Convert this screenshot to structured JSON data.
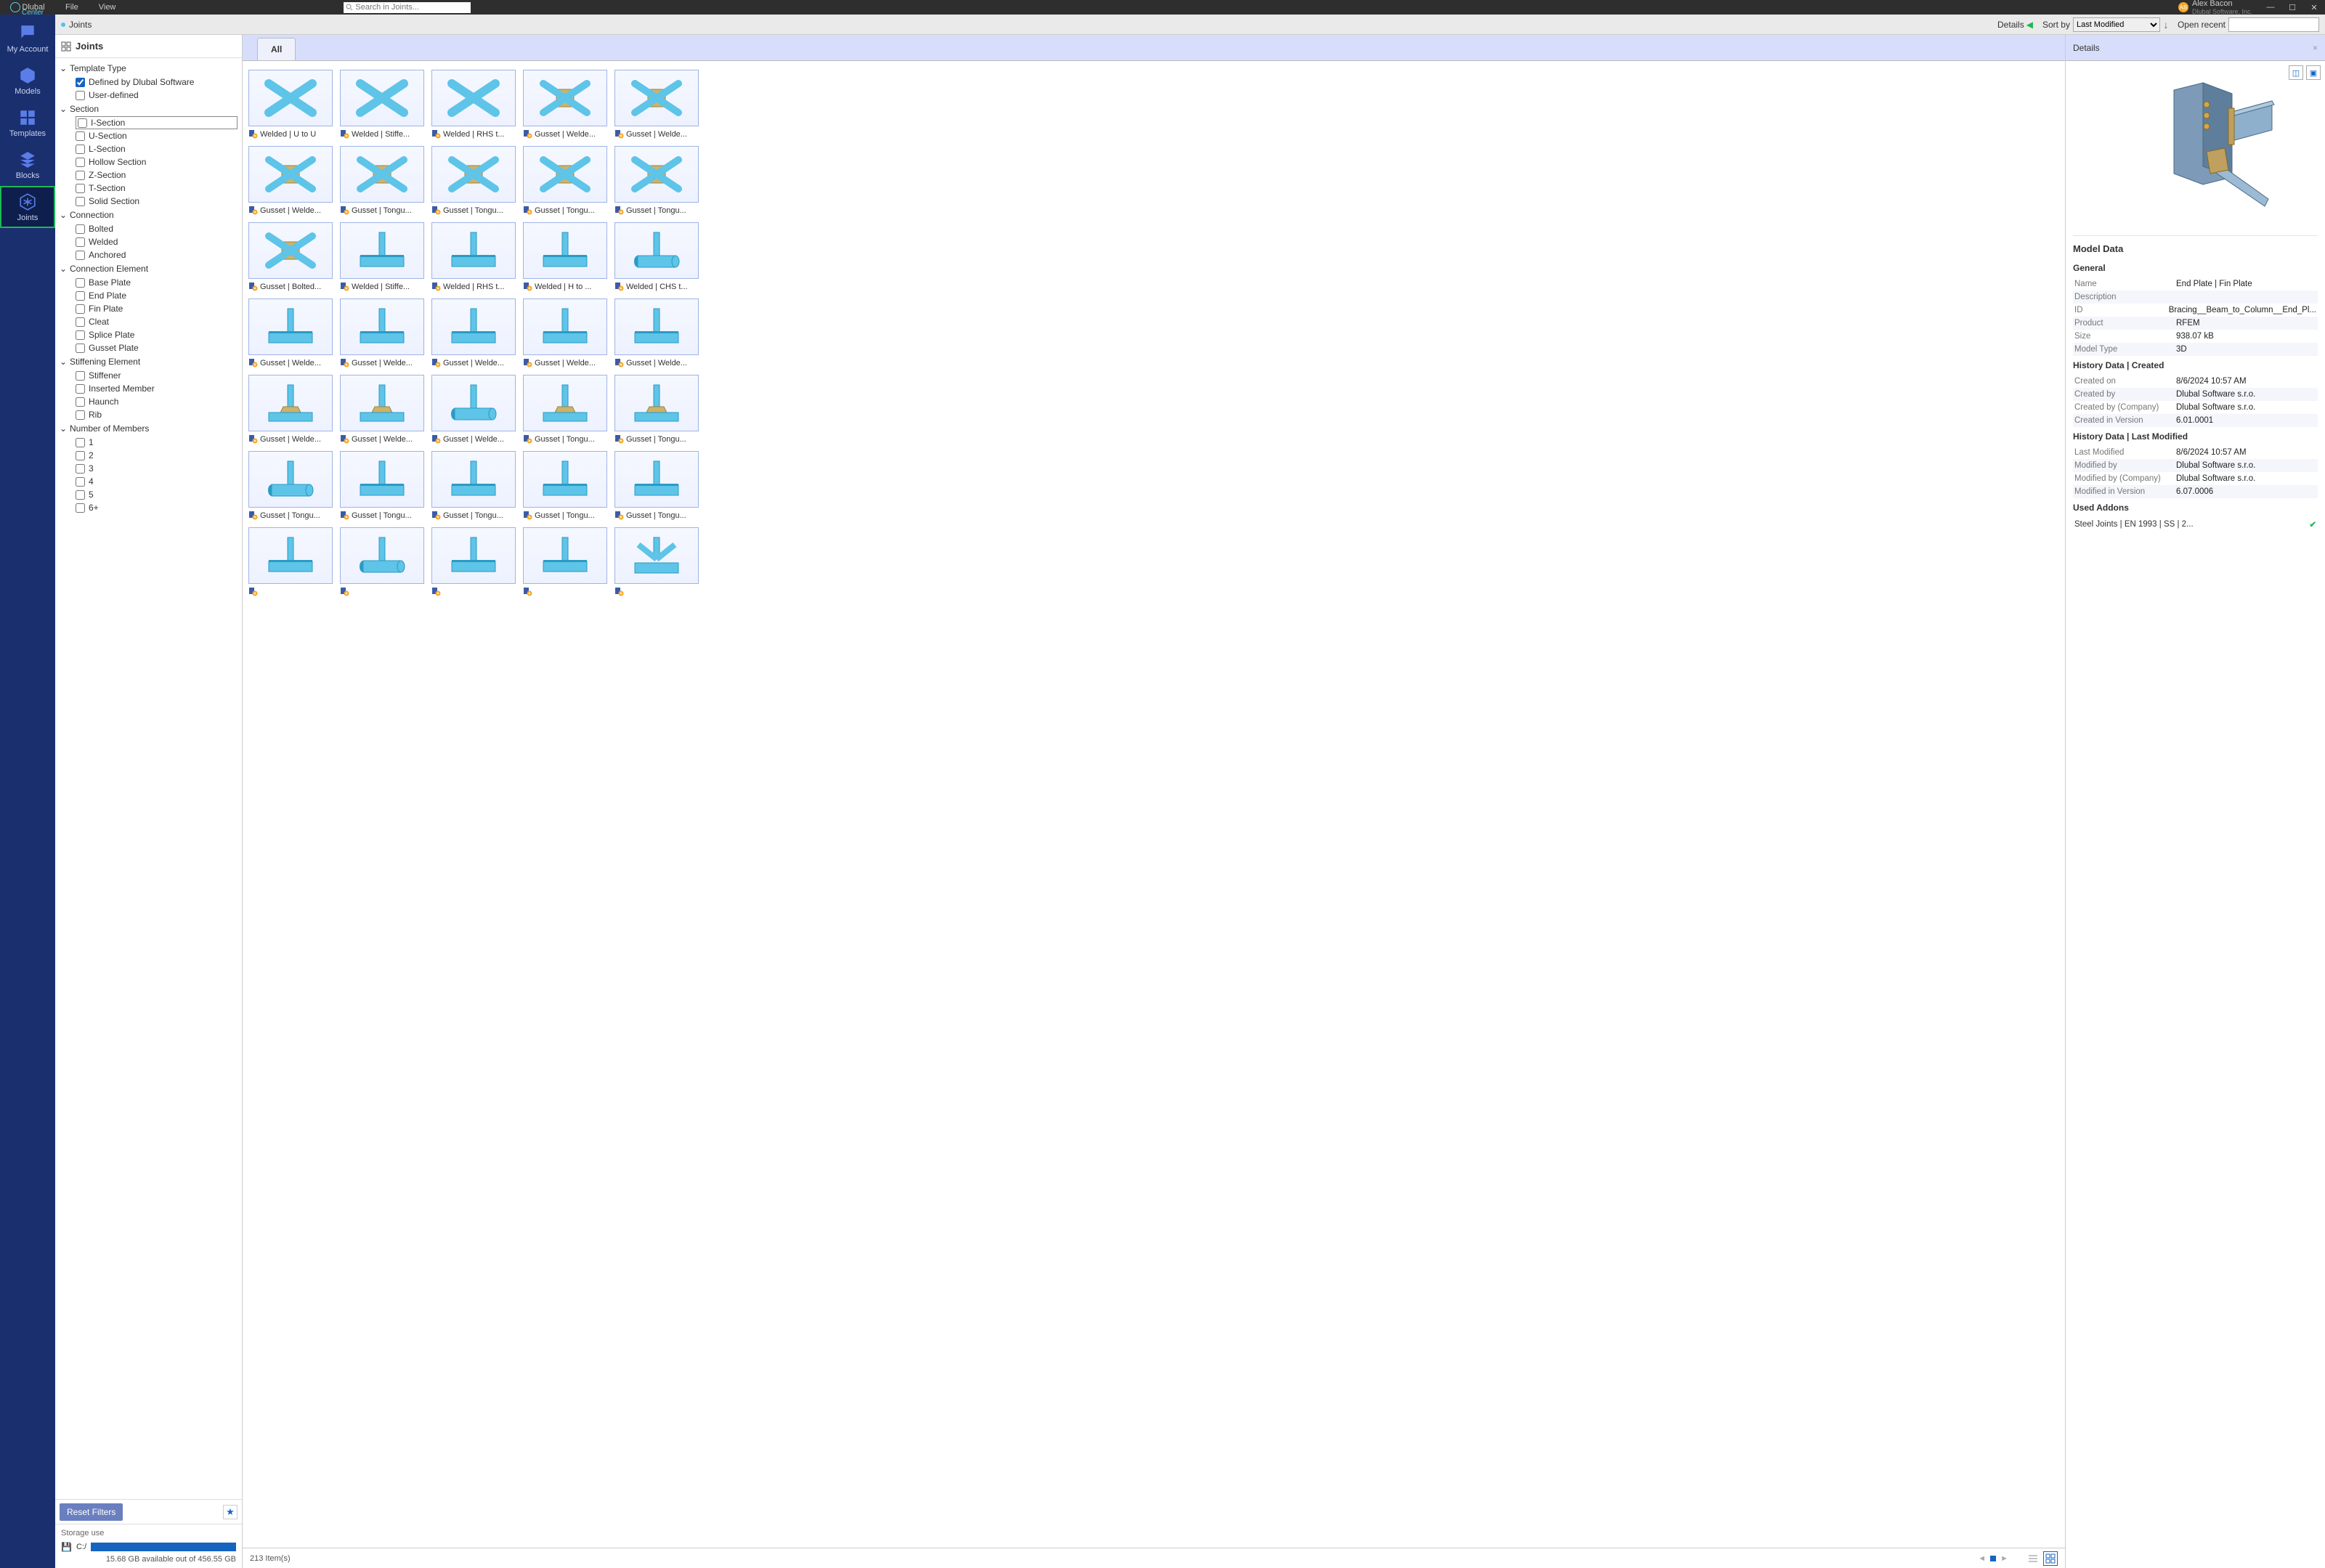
{
  "titlebar": {
    "brand": "Dlubal",
    "brand_sub": "Center",
    "menu": [
      "File",
      "View"
    ],
    "search_placeholder": "Search in Joints...",
    "user_name": "Alex Bacon",
    "user_company": "Dlubal Software, Inc.",
    "user_initials": "AB"
  },
  "iconbar": [
    {
      "label": "My Account"
    },
    {
      "label": "Models"
    },
    {
      "label": "Templates"
    },
    {
      "label": "Blocks"
    },
    {
      "label": "Joints",
      "active": true
    }
  ],
  "crumbbar": {
    "crumb": "Joints",
    "details_label": "Details",
    "sortby_label": "Sort by",
    "sort_value": "Last Modified",
    "open_recent_label": "Open recent"
  },
  "filter": {
    "title": "Joints",
    "groups": [
      {
        "title": "Template Type",
        "items": [
          {
            "label": "Defined by Dlubal Software",
            "checked": true
          },
          {
            "label": "User-defined"
          }
        ]
      },
      {
        "title": "Section",
        "items": [
          {
            "label": "I-Section",
            "highlight": true
          },
          {
            "label": "U-Section"
          },
          {
            "label": "L-Section"
          },
          {
            "label": "Hollow Section"
          },
          {
            "label": "Z-Section"
          },
          {
            "label": "T-Section"
          },
          {
            "label": "Solid Section"
          }
        ]
      },
      {
        "title": "Connection",
        "items": [
          {
            "label": "Bolted"
          },
          {
            "label": "Welded"
          },
          {
            "label": "Anchored"
          }
        ]
      },
      {
        "title": "Connection Element",
        "items": [
          {
            "label": "Base Plate"
          },
          {
            "label": "End Plate"
          },
          {
            "label": "Fin Plate"
          },
          {
            "label": "Cleat"
          },
          {
            "label": "Splice Plate"
          },
          {
            "label": "Gusset Plate"
          }
        ]
      },
      {
        "title": "Stiffening Element",
        "items": [
          {
            "label": "Stiffener"
          },
          {
            "label": "Inserted Member"
          },
          {
            "label": "Haunch"
          },
          {
            "label": "Rib"
          }
        ]
      },
      {
        "title": "Number of Members",
        "items": [
          {
            "label": "1"
          },
          {
            "label": "2"
          },
          {
            "label": "3"
          },
          {
            "label": "4"
          },
          {
            "label": "5"
          },
          {
            "label": "6+"
          }
        ]
      }
    ],
    "reset_label": "Reset Filters",
    "storage_title": "Storage use",
    "storage_drive": "C:/",
    "storage_text": "15.68 GB available out of 456.55 GB"
  },
  "gallery": {
    "tab_all": "All",
    "items": [
      {
        "label": "Welded | U to U",
        "shape": "x"
      },
      {
        "label": "Welded | Stiffe...",
        "shape": "x"
      },
      {
        "label": "Welded | RHS t...",
        "shape": "x"
      },
      {
        "label": "Gusset | Welde...",
        "shape": "x_plate"
      },
      {
        "label": "Gusset | Welde...",
        "shape": "x_plate"
      },
      {
        "label": "Gusset | Welde...",
        "shape": "x_plate"
      },
      {
        "label": "Gusset | Tongu...",
        "shape": "x_plate"
      },
      {
        "label": "Gusset | Tongu...",
        "shape": "x_plate"
      },
      {
        "label": "Gusset | Tongu...",
        "shape": "x_plate"
      },
      {
        "label": "Gusset | Tongu...",
        "shape": "x_plate"
      },
      {
        "label": "Gusset | Bolted...",
        "shape": "x_plate"
      },
      {
        "label": "Welded | Stiffe...",
        "shape": "t_beam"
      },
      {
        "label": "Welded | RHS t...",
        "shape": "t_beam"
      },
      {
        "label": "Welded | H to ...",
        "shape": "t_beam"
      },
      {
        "label": "Welded | CHS t...",
        "shape": "t_pipe"
      },
      {
        "label": "Gusset | Welde...",
        "shape": "t_beam"
      },
      {
        "label": "Gusset | Welde...",
        "shape": "t_beam"
      },
      {
        "label": "Gusset | Welde...",
        "shape": "t_beam"
      },
      {
        "label": "Gusset | Welde...",
        "shape": "t_beam"
      },
      {
        "label": "Gusset | Welde...",
        "shape": "t_beam"
      },
      {
        "label": "Gusset | Welde...",
        "shape": "t_haunch"
      },
      {
        "label": "Gusset | Welde...",
        "shape": "t_haunch"
      },
      {
        "label": "Gusset | Welde...",
        "shape": "t_pipe"
      },
      {
        "label": "Gusset | Tongu...",
        "shape": "t_haunch"
      },
      {
        "label": "Gusset | Tongu...",
        "shape": "t_haunch"
      },
      {
        "label": "Gusset | Tongu...",
        "shape": "t_pipe"
      },
      {
        "label": "Gusset | Tongu...",
        "shape": "t_beam"
      },
      {
        "label": "Gusset | Tongu...",
        "shape": "t_beam"
      },
      {
        "label": "Gusset | Tongu...",
        "shape": "t_beam"
      },
      {
        "label": "Gusset | Tongu...",
        "shape": "t_beam"
      },
      {
        "label": "",
        "shape": "t_beam"
      },
      {
        "label": "",
        "shape": "t_pipe"
      },
      {
        "label": "",
        "shape": "t_beam"
      },
      {
        "label": "",
        "shape": "t_beam"
      },
      {
        "label": "",
        "shape": "k_brace"
      }
    ],
    "footer_count": "213 Item(s)"
  },
  "details": {
    "title": "Details",
    "model_data_title": "Model Data",
    "general_title": "General",
    "general_rows": [
      {
        "k": "Name",
        "v": "End Plate | Fin Plate"
      },
      {
        "k": "Description",
        "v": ""
      },
      {
        "k": "ID",
        "v": "Bracing__Beam_to_Column__End_Pl..."
      },
      {
        "k": "Product",
        "v": "RFEM"
      },
      {
        "k": "Size",
        "v": "938.07 kB"
      },
      {
        "k": "Model Type",
        "v": "3D"
      }
    ],
    "history_created_title": "History Data | Created",
    "history_created_rows": [
      {
        "k": "Created on",
        "v": "8/6/2024 10:57 AM"
      },
      {
        "k": "Created by",
        "v": "Dlubal Software s.r.o."
      },
      {
        "k": "Created by (Company)",
        "v": "Dlubal Software s.r.o."
      },
      {
        "k": "Created in Version",
        "v": "6.01.0001"
      }
    ],
    "history_modified_title": "History Data | Last Modified",
    "history_modified_rows": [
      {
        "k": "Last Modified",
        "v": "8/6/2024 10:57 AM"
      },
      {
        "k": "Modified by",
        "v": "Dlubal Software s.r.o."
      },
      {
        "k": "Modified by (Company)",
        "v": "Dlubal Software s.r.o."
      },
      {
        "k": "Modified in Version",
        "v": "6.07.0006"
      }
    ],
    "addons_title": "Used Addons",
    "addons": [
      "Steel Joints | EN 1993 | SS | 2..."
    ]
  }
}
